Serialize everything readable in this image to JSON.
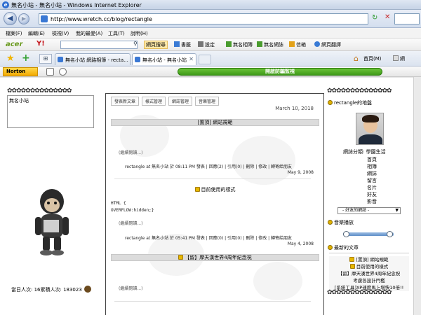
{
  "window": {
    "title": "無名小站 - 無名小站 - Windows Internet Explorer"
  },
  "address": {
    "url": "http://www.wretch.cc/blog/rectangle"
  },
  "menu": [
    "檔案(F)",
    "編輯(E)",
    "檢視(V)",
    "我的最愛(A)",
    "工具(T)",
    "說明(H)"
  ],
  "toolbar1": {
    "acer": "acer",
    "yahoo": "Y!",
    "search_btn": "網頁搜尋",
    "bookmark": "書籤",
    "settings": "設定",
    "album": "無名相簿",
    "blog": "無名網誌",
    "mail": "信箱",
    "translate": "網頁翻譯"
  },
  "tabs": [
    {
      "label": "無名小站 網路相簿 - recta..."
    },
    {
      "label": "無名小站 - 無名小站"
    }
  ],
  "toolbar2": {
    "home": "首頁(M)",
    "page": "網"
  },
  "norton": {
    "label": "Norton",
    "bar_text": "開啟防騙監視"
  },
  "site": {
    "name": "無名小站"
  },
  "counter": {
    "text": "當日人次: 16累積人次: 183023"
  },
  "main": {
    "subnav": [
      "發表新文章",
      "樣式管理",
      "網誌管理",
      "音樂管理"
    ],
    "date1": "March 10, 2018",
    "post1_title": "[置頂] 網站規範",
    "readmore": "(繼續閱讀...)",
    "post1_meta": "rectangle at 無名小站 於 08:11 PM 發表 | 回應(2) | 引用(0) | 刪除 | 修改 | 轉寄給朋友",
    "post1_date": "May 9, 2008",
    "post2_title": "目前使用的樣式",
    "code_line1": "HTML {",
    "code_line2": "OVERFLOW:hidden;}",
    "post2_meta": "rectangle at 無名小站 於 05:41 PM 發表 | 回應(0) | 引用(0) | 刪除 | 修改 | 轉寄給朋友",
    "post2_date": "May 4, 2008",
    "post3_title": "【留】摩天漢世界4周年紀念祝",
    "readmore3": "(繼續閱讀...)"
  },
  "sidebar": {
    "profile_title": "rectangle的地盤",
    "category": "網誌分類: 學園生活",
    "links": [
      "首頁",
      "相簿",
      "網誌",
      "留言",
      "名片",
      "好友",
      "影音"
    ],
    "friend_select": "- 好友的網誌 -",
    "music_title": "音樂播放",
    "latest_title": "最新的文章",
    "articles": [
      "[置頂] 網站規範",
      "目前使用的樣式",
      "【留】摩天漢世界4周年紀念祝",
      "考慮各設計門檻",
      "[系統工具]XP速度馬上增快10倍!!"
    ]
  }
}
